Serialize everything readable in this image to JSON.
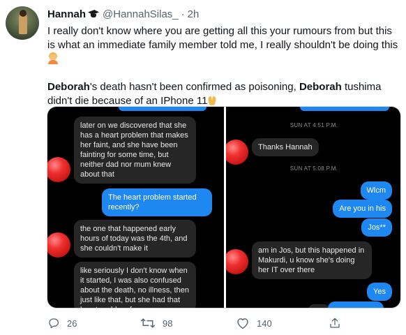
{
  "tweet": {
    "author_name": "Hannah",
    "handle": "@HannahSilas_",
    "separator": "·",
    "time": "2h",
    "paragraph1": "I really don't know where you are getting all this your rumours from but this is what an immediate family member told me, I really shouldn't be doing this",
    "para2_name1": "Deborah",
    "para2_text1": "'s death hasn't been confirmed as poisoning, ",
    "para2_name2": "Deborah",
    "para2_text2": " tushima didn't die because of an IPhone 11"
  },
  "left_chat": {
    "msg1": "later on we discovered that she has a heart problem that makes her faint, and she have been fainting for some time, but neither dad nor mum knew about that",
    "msg2": "The heart problem started recently?",
    "msg3": "the one that happened early hours of today was the 4th, and she couldn't make it",
    "msg4": "like seriously I don't know when it started, I was also confused about the death, no illness, then just like that, but she had that heart problem for some"
  },
  "right_chat": {
    "stamp1": "SUN AT 4:51 P.M.",
    "msg1": "Thanks Hannah",
    "stamp2": "SUN AT 5:08 P.M.",
    "msg2": "Wlcm",
    "msg3": "Are you in his",
    "msg4": "Jos**",
    "msg5": "am in Jos, but this happened in Makurdi, u know she's doing her IT over there",
    "msg6": "Yes"
  },
  "actions": {
    "replies": "26",
    "retweets": "98",
    "likes": "140"
  },
  "colors": {
    "chat_bg": "#000000",
    "incoming_bubble": "#262626",
    "outgoing_bubble": "#1e87f0",
    "muted_text": "#536471"
  }
}
